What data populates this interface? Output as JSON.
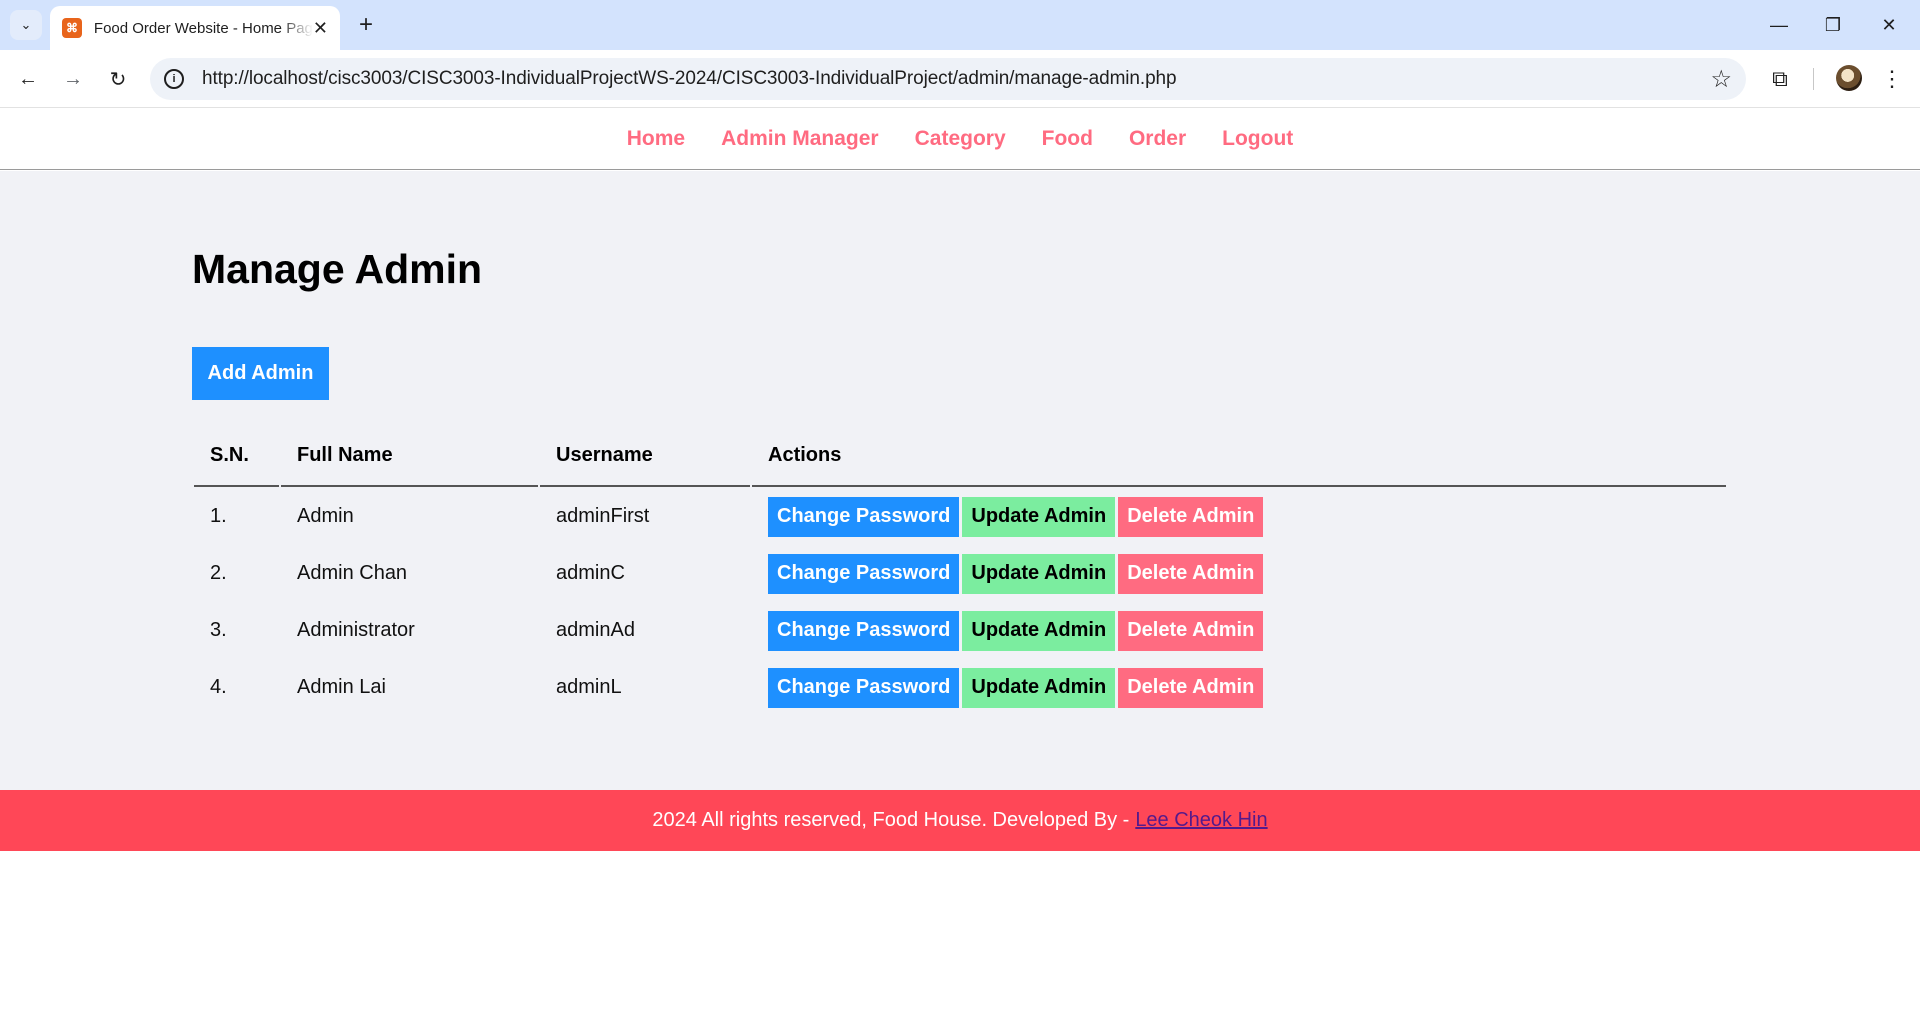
{
  "browser": {
    "tab_title": "Food Order Website - Home Page",
    "favicon_glyph": "⌘",
    "url": "http://localhost/cisc3003/CISC3003-IndividualProjectWS-2024/CISC3003-IndividualProject/admin/manage-admin.php",
    "icons": {
      "tab_search": "chevron-down-icon",
      "close_tab": "close-icon",
      "new_tab": "plus-icon",
      "back": "arrow-left-icon",
      "forward": "arrow-right-icon",
      "reload": "reload-icon",
      "site_info": "info-icon",
      "bookmark": "star-icon",
      "extensions": "puzzle-icon",
      "menu": "kebab-icon"
    },
    "glyphs": {
      "tab_search": "⌄",
      "close": "✕",
      "new_tab": "+",
      "back": "←",
      "forward": "→",
      "reload": "↻",
      "info": "i",
      "star": "☆",
      "extensions": "⧉",
      "menu": "⋮",
      "minimize": "—",
      "restore": "❐",
      "window_close": "✕"
    }
  },
  "nav": {
    "items": [
      {
        "label": "Home"
      },
      {
        "label": "Admin Manager"
      },
      {
        "label": "Category"
      },
      {
        "label": "Food"
      },
      {
        "label": "Order"
      },
      {
        "label": "Logout"
      }
    ]
  },
  "main": {
    "title": "Manage Admin",
    "add_button": "Add Admin",
    "table": {
      "headers": [
        "S.N.",
        "Full Name",
        "Username",
        "Actions"
      ],
      "rows": [
        {
          "sn": "1.",
          "full_name": "Admin",
          "username": "adminFirst"
        },
        {
          "sn": "2.",
          "full_name": "Admin Chan",
          "username": "adminC"
        },
        {
          "sn": "3.",
          "full_name": "Administrator",
          "username": "adminAd"
        },
        {
          "sn": "4.",
          "full_name": "Admin Lai",
          "username": "adminL"
        }
      ],
      "actions": {
        "change_password": "Change Password",
        "update": "Update Admin",
        "delete": "Delete Admin"
      }
    }
  },
  "footer": {
    "text": "2024 All rights reserved, Food House. Developed By -",
    "link": "Lee Cheok Hin"
  },
  "colors": {
    "nav_link": "#ff6b81",
    "primary": "#1e90ff",
    "success": "#7bed9f",
    "danger": "#ff6b81",
    "footer_bg": "#ff4757",
    "page_bg": "#f1f2f6"
  }
}
